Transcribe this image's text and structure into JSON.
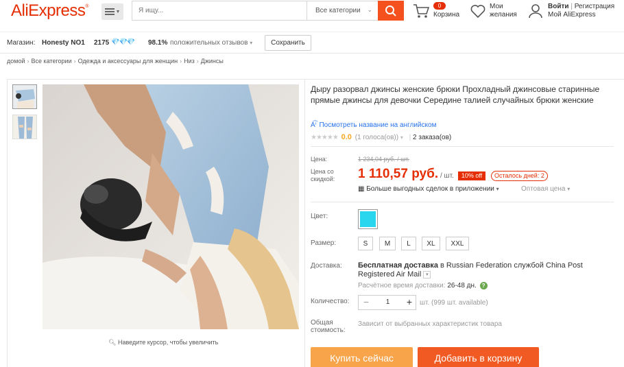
{
  "header": {
    "logo": "AliExpress",
    "logo_mark": "®",
    "search_placeholder": "Я ищу...",
    "search_category": "Все категории",
    "cart_count": "0",
    "cart_label": "Корзина",
    "wishlist_line1": "Мои",
    "wishlist_line2": "желания",
    "login": "Войти",
    "divider": "|",
    "register": "Регистрация",
    "my_account": "Мой AliExpress"
  },
  "store": {
    "label": "Магазин:",
    "name": "Honesty NO1",
    "score": "2175",
    "diamonds": "💎💎💎",
    "positive_pct": "98.1%",
    "positive_label": "положительных отзывов",
    "save_label": "Сохранить"
  },
  "breadcrumb": [
    "домой",
    "Все категории",
    "Одежда и аксессуары для женщин",
    "Низ",
    "Джинсы"
  ],
  "gallery": {
    "zoom_hint": "Наведите курсор, чтобы увеличить"
  },
  "product": {
    "title": "Дыру разорвал джинсы женские брюки Прохладный джинсовые старинные прямые джинсы для девочки Середине талией случайных брюки женские",
    "translate_label": "Посмотреть название на английском",
    "rating_score": "0.0",
    "rating_votes": "(1 голоса(ов))",
    "orders": "2 заказа(ов)",
    "price_label": "Цена:",
    "old_price": "1 234,04 руб. / шт.",
    "sale_label_1": "Цена со",
    "sale_label_2": "скидкой:",
    "new_price": "1 110,57 руб.",
    "unit": "/ шт.",
    "discount": "10% off",
    "days_left": "Осталось дней: 2",
    "app_deals": "Больше выгодных сделок в приложении",
    "wholesale": "Оптовая цена",
    "color_label": "Цвет:",
    "color_value": "#2ad6ee",
    "size_label": "Размер:",
    "sizes": [
      "S",
      "M",
      "L",
      "XL",
      "XXL"
    ],
    "delivery_label": "Доставка:",
    "delivery_free": "Бесплатная доставка",
    "delivery_in": "в",
    "delivery_country": "Russian Federation",
    "delivery_by": "службой",
    "delivery_service": "China Post Registered Air Mail",
    "est_label": "Расчётное время доставки:",
    "est_value": "26-48 дн.",
    "qty_label": "Количество:",
    "qty_minus": "−",
    "qty_value": "1",
    "qty_plus": "+",
    "qty_available": "шт. (999 шт. available)",
    "total_label_1": "Общая",
    "total_label_2": "стоимость:",
    "total_note": "Зависит от выбранных характеристик товара",
    "buy_now": "Купить сейчас",
    "add_to_cart": "Добавить в корзину"
  },
  "colors": {
    "brand": "#e62e04",
    "search_button": "#f4511e",
    "buy_button": "#f7a44a",
    "cart_button": "#f15a22",
    "link": "#2672ec"
  }
}
